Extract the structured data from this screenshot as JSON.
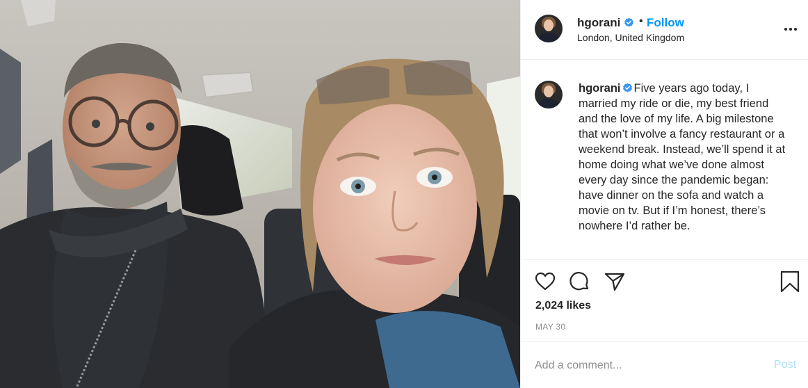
{
  "post": {
    "username": "hgorani",
    "verified": true,
    "separator": "•",
    "follow_label": "Follow",
    "location": "London, United Kingdom",
    "caption": "Five years ago today, I married my ride or die, my best friend and the love of my life. A big milestone that won’t involve a fancy restaurant or a weekend break. Instead, we’ll spend it at home doing what we’ve done almost every day since the pandemic began: have dinner on the sofa and watch a movie on tv. But if I’m honest, there’s nowhere I’d rather be.",
    "likes": "2,024 likes",
    "date": "MAY 30"
  },
  "comment": {
    "placeholder": "Add a comment...",
    "post_label": "Post"
  },
  "icons": {
    "more": "more-options-icon",
    "like": "heart-icon",
    "comment": "comment-icon",
    "share": "paper-plane-icon",
    "save": "bookmark-icon",
    "verified": "verified-badge-icon"
  },
  "colors": {
    "link": "#0095f6",
    "post_disabled": "#b2dffc",
    "muted": "#8e8e8e",
    "verified": "#3897f0"
  }
}
